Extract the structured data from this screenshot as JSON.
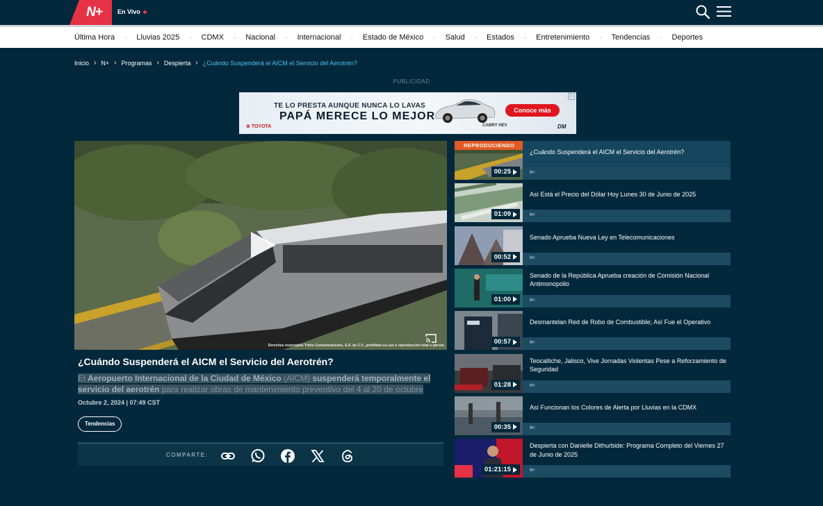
{
  "brand": {
    "logo_text": "N+",
    "live_label": "En Vivo",
    "accent": "#e63246"
  },
  "nav": {
    "items": [
      "Última Hora",
      "Lluvias 2025",
      "CDMX",
      "Nacional",
      "Internacional",
      "Estado de México",
      "Salud",
      "Estados",
      "Entretenimiento",
      "Tendencias",
      "Deportes"
    ],
    "separator": "·"
  },
  "breadcrumb": {
    "items": [
      "Inicio",
      "N+",
      "Programas",
      "Despierta"
    ],
    "current": "¿Cuándo Suspenderá el AICM el Servicio del Aerotrén?"
  },
  "ad": {
    "label": "PUBLICIDAD",
    "line1": "TE LO PRESTA AUNQUE NUNCA LO LAVAS",
    "line2": "PAPÁ MERECE LO MEJOR",
    "cta": "Conoce más",
    "brand": "TOYOTA",
    "model": "CAMRY HEV",
    "dealer": "DM",
    "close": "▷"
  },
  "video": {
    "copyright": "Derechos reservados Tritón Comunicaciones, S.A. de C.V., prohibido su uso o reproducción total o parcial."
  },
  "article": {
    "title": "¿Cuándo Suspenderá el AICM el Servicio del Aerotrén?",
    "desc_1": "El ",
    "desc_b1": "Aeropuerto Internacional de la Ciudad de México",
    "desc_2": " (AICM) ",
    "desc_b2": "suspenderá temporalmente el servicio del aerotrén",
    "desc_3": " para realizar obras de mantenimiento preventivo del 4 al 20 de octubre",
    "date": "Octubre 2, 2024 | 07:49 CST",
    "tag": "Tendencias"
  },
  "share": {
    "label": "COMPARTE:",
    "icons": [
      "link-icon",
      "whatsapp-icon",
      "facebook-icon",
      "x-icon",
      "threads-icon"
    ]
  },
  "related": {
    "now_playing": "REPRODUCIENDO",
    "channel": "N+",
    "items": [
      {
        "title": "¿Cuándo Suspenderá el AICM el Servicio del Aerotrén?",
        "duration": "00:25"
      },
      {
        "title": "Así Está el Precio del Dólar Hoy Lunes 30 de Junio de 2025",
        "duration": "01:09"
      },
      {
        "title": "Senado Aprueba Nueva Ley en Telecomunicaciones",
        "duration": "00:52"
      },
      {
        "title": "Senado de la República Aprueba creación de Comisión Nacional Antimonopolio",
        "duration": "01:00"
      },
      {
        "title": "Desmantelan Red de Robo de Combustible; Así Fue el Operativo",
        "duration": "00:57"
      },
      {
        "title": "Teocaltiche, Jalisco, Vive Jornadas Violentas Pese a Reforzamiento de Seguridad",
        "duration": "01:28"
      },
      {
        "title": "Así Funcionan los Colores de Alerta por Lluvias en la CDMX",
        "duration": "00:35"
      },
      {
        "title": "Despierta con Danielle Dithurbide: Programa Completo del Viernes 27 de Junio de 2025",
        "duration": "01:21:15"
      }
    ]
  }
}
